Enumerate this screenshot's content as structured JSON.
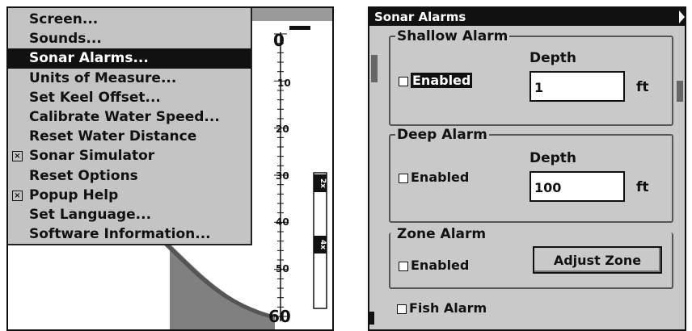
{
  "left_screen": {
    "depth_scale": [
      "0",
      "10",
      "20",
      "30",
      "40",
      "50",
      "60"
    ],
    "zoom_labels": [
      "2x",
      "4x"
    ],
    "menu": {
      "items": [
        {
          "label": "Screen...",
          "checked": null,
          "selected": false
        },
        {
          "label": "Sounds...",
          "checked": null,
          "selected": false
        },
        {
          "label": "Sonar Alarms...",
          "checked": null,
          "selected": true
        },
        {
          "label": "Units of Measure...",
          "checked": null,
          "selected": false
        },
        {
          "label": "Set Keel Offset...",
          "checked": null,
          "selected": false
        },
        {
          "label": "Calibrate Water Speed...",
          "checked": null,
          "selected": false
        },
        {
          "label": "Reset Water Distance",
          "checked": null,
          "selected": false
        },
        {
          "label": "Sonar Simulator",
          "checked": true,
          "selected": false
        },
        {
          "label": "Reset Options",
          "checked": null,
          "selected": false
        },
        {
          "label": "Popup Help",
          "checked": true,
          "selected": false
        },
        {
          "label": "Set Language...",
          "checked": null,
          "selected": false
        },
        {
          "label": "Software Information...",
          "checked": null,
          "selected": false
        }
      ]
    }
  },
  "dialog": {
    "title": "Sonar Alarms",
    "shallow": {
      "legend": "Shallow Alarm",
      "enabled_label": "Enabled",
      "depth_label": "Depth",
      "depth_value": "1",
      "unit": "ft"
    },
    "deep": {
      "legend": "Deep Alarm",
      "enabled_label": "Enabled",
      "depth_label": "Depth",
      "depth_value": "100",
      "unit": "ft"
    },
    "zone": {
      "legend": "Zone Alarm",
      "enabled_label": "Enabled",
      "adjust_button": "Adjust Zone"
    },
    "fish": {
      "label": "Fish Alarm"
    }
  },
  "colors": {
    "menu_bg": "#c4c4c4",
    "dialog_bg": "#c9c9c9",
    "highlight": "#111111"
  }
}
